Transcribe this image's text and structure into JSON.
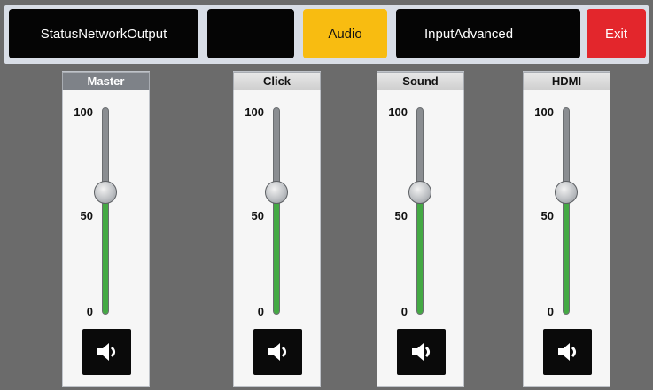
{
  "tabs": [
    {
      "label": "StatusNetworkOutput",
      "state": "normal"
    },
    {
      "label": "",
      "state": "normal"
    },
    {
      "label": "Audio",
      "state": "active"
    },
    {
      "label": "InputAdvanced",
      "state": "normal"
    },
    {
      "label": "Exit",
      "state": "exit"
    }
  ],
  "colors": {
    "active_tab": "#f8bc11",
    "exit": "#e3262c",
    "level_fill": "#44a944"
  },
  "scale": {
    "max": "100",
    "mid": "50",
    "min": "0"
  },
  "channels": [
    {
      "name": "Master",
      "level": 0.59,
      "icon": "speaker-icon"
    },
    {
      "name": "Click",
      "level": 0.59,
      "icon": "speaker-icon"
    },
    {
      "name": "Sound",
      "level": 0.59,
      "icon": "speaker-icon"
    },
    {
      "name": "HDMI",
      "level": 0.59,
      "icon": "speaker-icon"
    }
  ]
}
